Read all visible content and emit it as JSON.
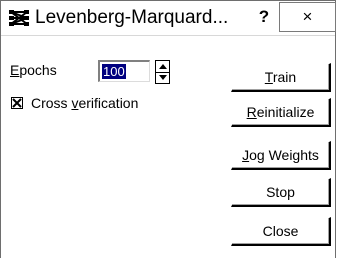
{
  "window": {
    "icon": "network-app-icon",
    "title": "Levenberg-Marquard...",
    "help_label": "?",
    "close_label": "×"
  },
  "epochs": {
    "label_mnemonic": "E",
    "label_rest": "pochs",
    "value": "100"
  },
  "cross_verification": {
    "checked": true,
    "label_before": "Cross ",
    "label_mnemonic": "v",
    "label_after": "erification"
  },
  "buttons": {
    "train": {
      "mnemonic": "T",
      "rest": "rain"
    },
    "reinitialize": {
      "mnemonic": "R",
      "rest": "einitialize"
    },
    "jog_weights": {
      "mnemonic": "J",
      "rest": "og Weights"
    },
    "stop": {
      "label": "Stop"
    },
    "close": {
      "label": "Close"
    }
  }
}
